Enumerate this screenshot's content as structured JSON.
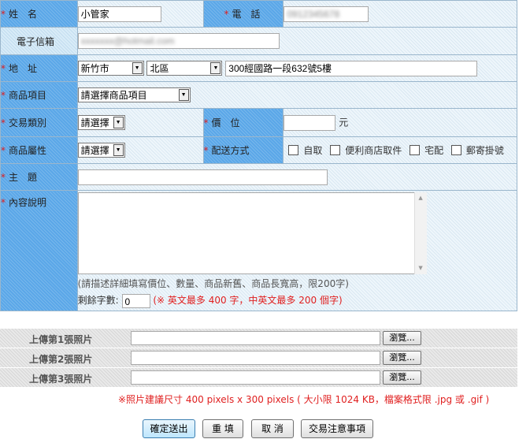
{
  "form": {
    "required_mark": "*",
    "name_label": "姓　名",
    "name_value": "小管家",
    "phone_label": "電　話",
    "phone_value": "0912345678",
    "email_label": "電子信箱",
    "email_value": "xxxxxxx@hotmail.com",
    "address_label": "地　址",
    "city_selected": "新竹市",
    "district_selected": "北區",
    "address_value": "300經國路一段632號5樓",
    "category_label": "商品項目",
    "category_selected": "請選擇商品項目",
    "trade_type_label": "交易類別",
    "trade_type_selected": "請選擇",
    "price_label": "價　位",
    "price_value": "",
    "price_unit": "元",
    "attribute_label": "商品屬性",
    "attribute_selected": "請選擇",
    "shipping_label": "配送方式",
    "shipping_options": [
      "自取",
      "便利商店取件",
      "宅配",
      "郵寄掛號"
    ],
    "subject_label": "主　題",
    "subject_value": "",
    "description_label": "內容說明",
    "description_hint": "(請描述詳細填寫價位、數量、商品新舊、商品長寬高，限200字)",
    "remaining_label": "剩餘字數:",
    "remaining_value": "0",
    "limit_note": "(※ 英文最多 400 字，中英文最多 200 個字)"
  },
  "photos": {
    "rows": [
      {
        "label": "上傳第1張照片",
        "button": "瀏覽..."
      },
      {
        "label": "上傳第2張照片",
        "button": "瀏覽..."
      },
      {
        "label": "上傳第3張照片",
        "button": "瀏覽..."
      }
    ],
    "note": "※照片建議尺寸 400 pixels  x  300 pixels ( 大小限 1024 KB，檔案格式限 .jpg 或 .gif )"
  },
  "actions": {
    "submit": "確定送出",
    "reset": "重 填",
    "cancel": "取 消",
    "notice": "交易注意事項"
  },
  "colors": {
    "label_bg": "#5aa7e8",
    "label_light_bg": "#d9ecf8",
    "required": "#e02020"
  }
}
